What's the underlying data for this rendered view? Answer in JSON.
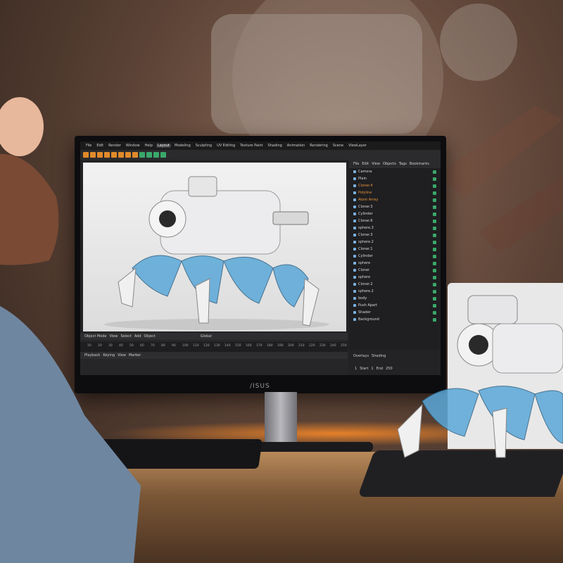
{
  "monitor": {
    "brand": "/ISUS",
    "menu": [
      "File",
      "Edit",
      "Render",
      "Window",
      "Help",
      "Layout",
      "Modeling",
      "Sculpting",
      "UV Editing",
      "Texture Paint",
      "Shading",
      "Animation",
      "Rendering",
      "Scene",
      "ViewLayer"
    ],
    "active_menu": "Layout",
    "outliner_tabs": [
      "File",
      "Edit",
      "View",
      "Objects",
      "Tags",
      "Bookmarks"
    ],
    "outliner_rows": [
      {
        "label": "Camera",
        "selected": false
      },
      {
        "label": "Plain",
        "selected": false
      },
      {
        "label": "Cloner.4",
        "selected": true
      },
      {
        "label": "Polyline",
        "selected": true
      },
      {
        "label": "Atom Array",
        "selected": true
      },
      {
        "label": "Cloner.3",
        "selected": false
      },
      {
        "label": "Cylinder",
        "selected": false
      },
      {
        "label": "Cloner.6",
        "selected": false
      },
      {
        "label": "sphere.3",
        "selected": false
      },
      {
        "label": "Cloner.3",
        "selected": false
      },
      {
        "label": "sphere.2",
        "selected": false
      },
      {
        "label": "Cloner.1",
        "selected": false
      },
      {
        "label": "Cylinder",
        "selected": false
      },
      {
        "label": "sphere",
        "selected": false
      },
      {
        "label": "Cloner",
        "selected": false
      },
      {
        "label": "sphere",
        "selected": false
      },
      {
        "label": "Cloner.2",
        "selected": false
      },
      {
        "label": "sphere.2",
        "selected": false
      },
      {
        "label": "body",
        "selected": false
      },
      {
        "label": "Push Apart",
        "selected": false
      },
      {
        "label": "Shader",
        "selected": false
      },
      {
        "label": "Background",
        "selected": false
      }
    ],
    "viewport_header": [
      "Object Mode",
      "View",
      "Select",
      "Add",
      "Object"
    ],
    "transform_orientation": "Global",
    "timeline_header": [
      "Playback",
      "Keying",
      "View",
      "Marker"
    ],
    "ruler_ticks": [
      "10",
      "20",
      "30",
      "40",
      "50",
      "60",
      "70",
      "80",
      "90",
      "100",
      "110",
      "120",
      "130",
      "140",
      "150",
      "160",
      "170",
      "180",
      "190",
      "200",
      "210",
      "220",
      "230",
      "240",
      "250"
    ],
    "overlays_label": "Overlays",
    "shading_label": "Shading",
    "frame_current": "1",
    "frame_start_label": "Start",
    "frame_start": "1",
    "frame_end_label": "End",
    "frame_end": "250"
  },
  "colors": {
    "accent_orange": "#e08a2a",
    "accent_green": "#3aa86a",
    "robot_blue": "#5aa8d8",
    "robot_white": "#e8e8ea"
  }
}
